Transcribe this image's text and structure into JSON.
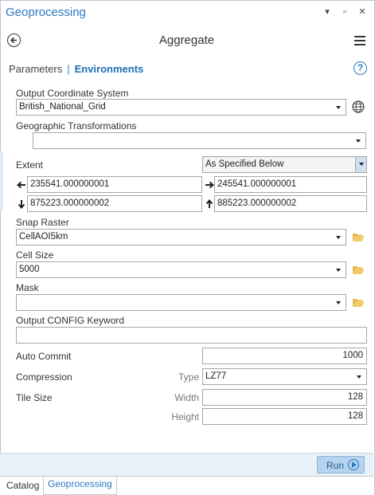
{
  "window": {
    "title": "Geoprocessing"
  },
  "header": {
    "title": "Aggregate"
  },
  "tabs": {
    "parameters": "Parameters",
    "separator": "|",
    "environments": "Environments"
  },
  "help": "?",
  "fields": {
    "output_coordinate_system": {
      "label": "Output Coordinate System",
      "value": "British_National_Grid"
    },
    "geographic_transformations": {
      "label": "Geographic Transformations",
      "value": ""
    },
    "extent": {
      "label": "Extent",
      "mode": "As Specified Below",
      "left": "235541.000000001",
      "right": "245541.000000001",
      "bottom": "875223.000000002",
      "top": "885223.000000002"
    },
    "snap_raster": {
      "label": "Snap Raster",
      "value": "CellAOI5km"
    },
    "cell_size": {
      "label": "Cell Size",
      "value": "5000"
    },
    "mask": {
      "label": "Mask",
      "value": ""
    },
    "output_config_keyword": {
      "label": "Output CONFIG Keyword",
      "value": ""
    },
    "auto_commit": {
      "label": "Auto Commit",
      "value": "1000"
    },
    "compression": {
      "label": "Compression",
      "type_label": "Type",
      "type_value": "LZ77"
    },
    "tile_size": {
      "label": "Tile Size",
      "width_label": "Width",
      "width_value": "128",
      "height_label": "Height",
      "height_value": "128"
    }
  },
  "footer": {
    "run_label": "Run"
  },
  "bottom_tabs": [
    "Catalog",
    "Geoprocessing"
  ],
  "colors": {
    "accent": "#2a79c1",
    "run_bg": "#b5d3ef",
    "footer_bg": "#e9f0f7"
  }
}
